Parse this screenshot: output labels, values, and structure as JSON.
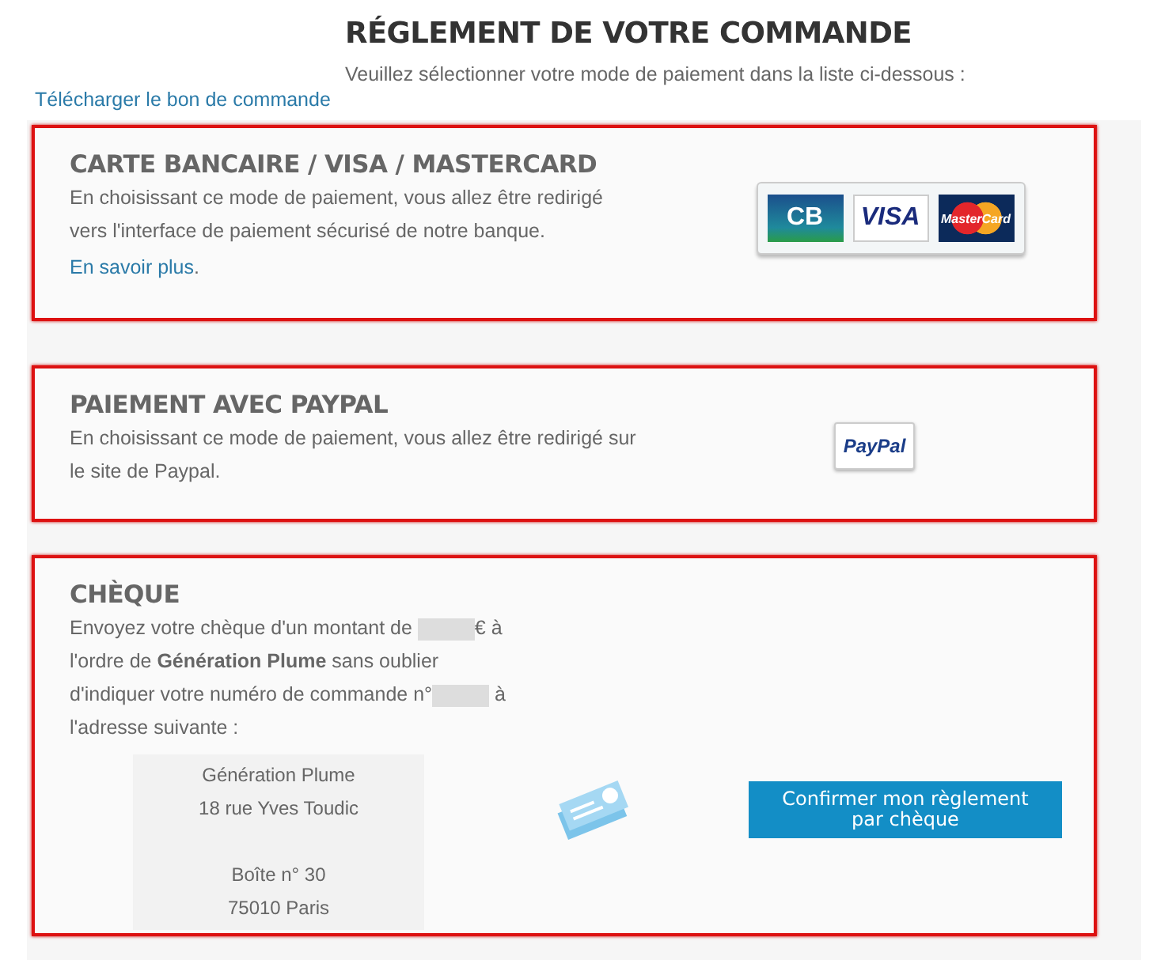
{
  "title": "RÉGLEMENT DE VOTRE COMMANDE",
  "subtitle": "Veuillez sélectionner votre mode de paiement dans la liste ci-dessous :",
  "download_link": "Télécharger le bon de commande",
  "methods": [
    {
      "kind": "card",
      "heading": "CARTE BANCAIRE / VISA / MASTERCARD",
      "description": "En choisissant ce mode de paiement, vous allez être redirigé vers l'interface de paiement sécurisé de notre banque.",
      "link": "En savoir plus",
      "link_suffix": ".",
      "logos": [
        "CB",
        "VISA",
        "MasterCard"
      ]
    },
    {
      "kind": "paypal",
      "heading": "PAIEMENT AVEC PAYPAL",
      "description": "En choisissant ce mode de paiement, vous allez être redirigé sur le site de Paypal.",
      "logos": [
        "PayPal"
      ]
    },
    {
      "kind": "cheque",
      "heading": "CHÈQUE",
      "segments": [
        {
          "kind": "text",
          "text": "Envoyez votre chèque d'un montant de "
        },
        {
          "kind": "redacted"
        },
        {
          "kind": "text",
          "text": "€ à l'ordre de **Génération Plume** sans oublier d'indiquer votre numéro de commande n°"
        },
        {
          "kind": "redacted"
        },
        {
          "kind": "text",
          "text": " à l'adresse suivante :"
        }
      ],
      "address": [
        [
          "Génération Plume",
          "18 rue Yves Toudic"
        ],
        [
          "Boîte n° 30",
          "75010 Paris"
        ]
      ],
      "button": "Confirmer mon règlement par chèque"
    }
  ]
}
